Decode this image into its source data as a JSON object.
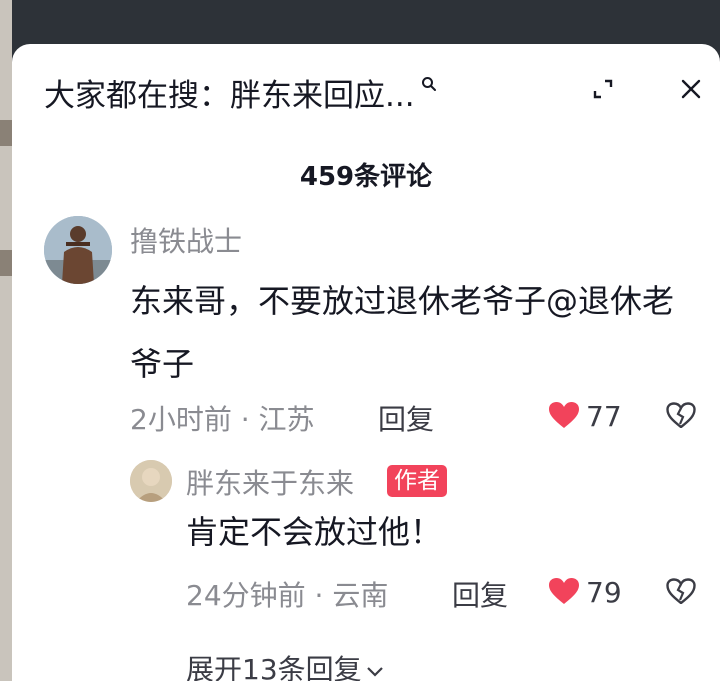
{
  "search": {
    "prefix": "大家都在搜：",
    "query": "胖东来回应..."
  },
  "comment_count": "459条评论",
  "comments": [
    {
      "username": "撸铁战士",
      "text": "东来哥，不要放过退休老爷子@退休老爷子",
      "time": "2小时前",
      "location": "江苏",
      "reply_label": "回复",
      "likes": "77",
      "replies": [
        {
          "username": "胖东来于东来",
          "badge": "作者",
          "text": "肯定不会放过他！",
          "time": "24分钟前",
          "location": "云南",
          "reply_label": "回复",
          "likes": "79"
        }
      ],
      "expand_label": "展开13条回复"
    }
  ],
  "colors": {
    "like": "#f2435b",
    "badge": "#f2435b",
    "secondary_text": "#8a8b91",
    "primary_text": "#161823"
  },
  "icons": [
    "search-icon",
    "expand-icon",
    "close-icon",
    "heart-icon",
    "broken-heart-icon",
    "chevron-down-icon"
  ]
}
